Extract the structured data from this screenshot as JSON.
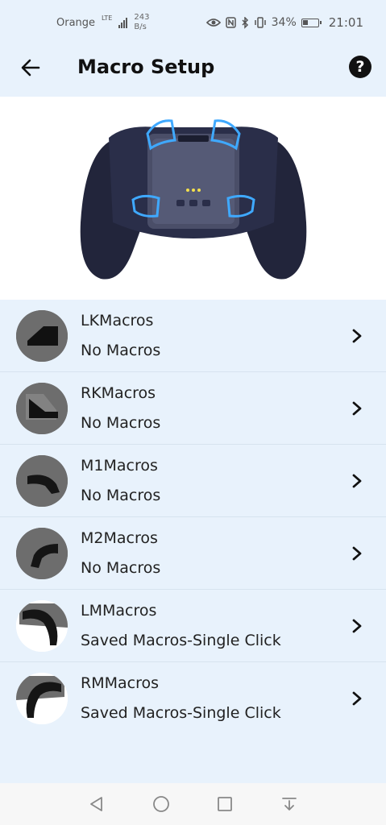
{
  "status_bar": {
    "carrier": "Orange",
    "network": "LTE",
    "speed_value": "243",
    "speed_unit": "B/s",
    "battery": "34%",
    "time": "21:01"
  },
  "header": {
    "title": "Macro Setup",
    "help_label": "?"
  },
  "macros": [
    {
      "name": "LKMacros",
      "status": "No Macros"
    },
    {
      "name": "RKMacros",
      "status": "No Macros"
    },
    {
      "name": "M1Macros",
      "status": "No Macros"
    },
    {
      "name": "M2Macros",
      "status": "No Macros"
    },
    {
      "name": "LMMacros",
      "status": "Saved Macros-Single  Click"
    },
    {
      "name": "RMMacros",
      "status": "Saved Macros-Single  Click"
    }
  ],
  "icons": {
    "back": "arrow-left-icon",
    "help": "question-circle-icon",
    "row_chevron": "chevron-right-icon",
    "nav_back": "triangle-back-icon",
    "nav_home": "circle-home-icon",
    "nav_recents": "square-recents-icon",
    "nav_notifications": "pull-down-icon"
  },
  "colors": {
    "background": "#e8f2fc",
    "hero_background": "#ffffff",
    "controller_body": "#20233a",
    "highlight": "#3fa9ff"
  }
}
